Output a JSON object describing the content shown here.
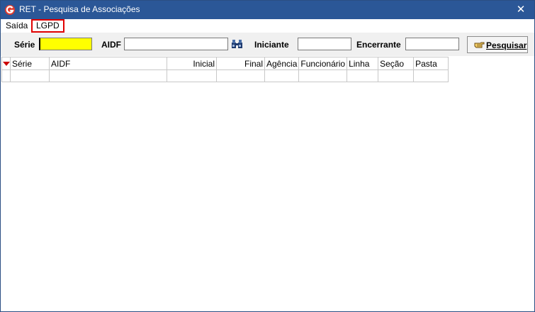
{
  "window": {
    "title": "RET - Pesquisa de Associações",
    "close_glyph": "✕",
    "icon": "app-logo-icon"
  },
  "menu": {
    "items": [
      {
        "label": "Saída"
      },
      {
        "label": "LGPD"
      }
    ]
  },
  "toolbar": {
    "serie_label": "Série",
    "serie_value": "",
    "aidf_label": "AIDF",
    "aidf_value": "",
    "iniciante_label": "Iniciante",
    "iniciante_value": "",
    "encerrante_label": "Encerrante",
    "encerrante_value": "",
    "search_button_label": "Pesquisar",
    "highlight_color": "#ffff00"
  },
  "grid": {
    "columns": [
      "Série",
      "AIDF",
      "Inicial",
      "Final",
      "Agência",
      "Funcionário",
      "Linha",
      "Seção",
      "Pasta"
    ],
    "rows": [
      [
        "",
        "",
        "",
        "",
        "",
        "",
        "",
        "",
        ""
      ]
    ]
  }
}
